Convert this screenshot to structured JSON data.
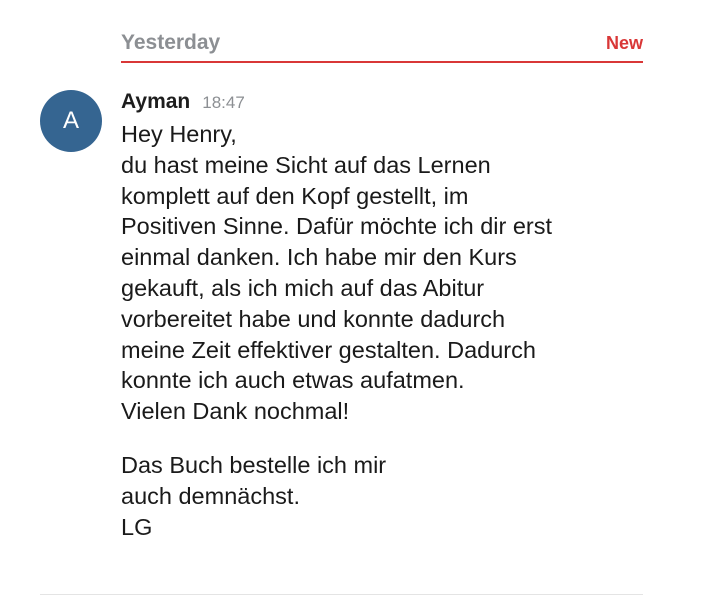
{
  "divider": {
    "date_label": "Yesterday",
    "new_label": "New",
    "accent_color": "#d93737"
  },
  "message": {
    "avatar_letter": "A",
    "avatar_color": "#356591",
    "author": "Ayman",
    "time": "18:47",
    "lines": [
      "Hey Henry,",
      "du hast meine Sicht auf das Lernen",
      "komplett auf den Kopf gestellt, im",
      "Positiven Sinne. Dafür möchte ich dir erst",
      "einmal danken. Ich habe mir den Kurs",
      "gekauft, als ich mich auf das Abitur",
      "vorbereitet habe und konnte dadurch",
      "meine Zeit effektiver gestalten. Dadurch",
      "konnte ich auch etwas aufatmen.",
      "Vielen Dank nochmal!",
      "",
      "Das Buch bestelle ich mir",
      "auch demnächst.",
      "LG"
    ]
  }
}
